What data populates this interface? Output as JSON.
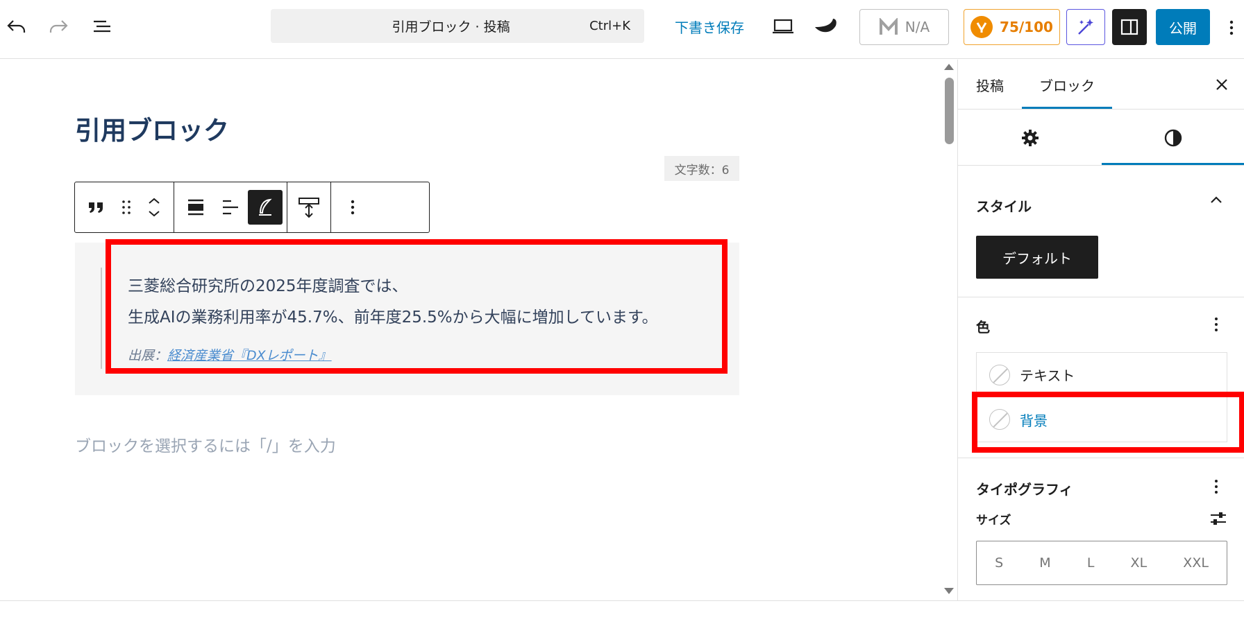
{
  "topbar": {
    "command_title": "引用ブロック · 投稿",
    "command_shortcut": "Ctrl+K",
    "save_draft": "下書き保存",
    "seo_na": "N/A",
    "seo_score": "75/100",
    "publish": "公開"
  },
  "editor": {
    "post_title": "引用ブロック",
    "word_count": "文字数：6",
    "quote_line1": "三菱総合研究所の2025年度調査では、",
    "quote_line2": "生成AIの業務利用率が45.7%、前年度25.5%から大幅に増加しています。",
    "cite_prefix": "出展：",
    "cite_link": "経済産業省『DXレポート』",
    "placeholder": "ブロックを選択するには「/」を入力"
  },
  "sidebar": {
    "tab_post": "投稿",
    "tab_block": "ブロック",
    "style_title": "スタイル",
    "style_default": "デフォルト",
    "color_title": "色",
    "color_text": "テキスト",
    "color_background": "背景",
    "typography_title": "タイポグラフィ",
    "size_label": "サイズ",
    "sizes": [
      "S",
      "M",
      "L",
      "XL",
      "XXL"
    ]
  },
  "colors": {
    "accent": "#007cba",
    "highlight": "#ff0000",
    "title": "#1f3a5f",
    "seo_orange": "#f08c00"
  }
}
